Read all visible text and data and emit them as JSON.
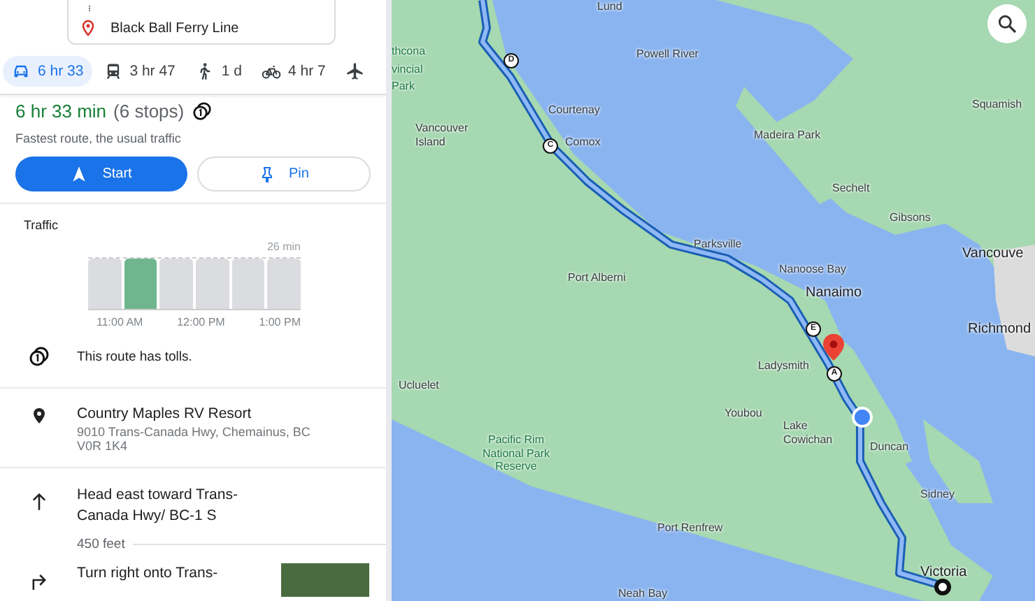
{
  "destination_card": {
    "label": "Black Ball Ferry Line"
  },
  "modes": [
    {
      "kind": "car",
      "label": "6 hr 33",
      "selected": true
    },
    {
      "kind": "transit",
      "label": "3 hr 47",
      "selected": false
    },
    {
      "kind": "walk",
      "label": "1 d",
      "selected": false
    },
    {
      "kind": "bike",
      "label": "4 hr 7",
      "selected": false
    },
    {
      "kind": "flight",
      "selected": false
    }
  ],
  "summary": {
    "duration": "6 hr 33 min",
    "stops": "(6 stops)",
    "note": "Fastest route, the usual traffic"
  },
  "buttons": {
    "start": "Start",
    "pin": "Pin"
  },
  "traffic": {
    "title": "Traffic",
    "top_label": "26 min",
    "times": [
      "11:00 AM",
      "12:00 PM",
      "1:00 PM"
    ],
    "bars": [
      {
        "selected": false
      },
      {
        "selected": true
      },
      {
        "selected": false
      },
      {
        "selected": false
      },
      {
        "selected": false
      },
      {
        "selected": false
      }
    ]
  },
  "tolls_note": "This route has tolls.",
  "place": {
    "name": "Country Maples RV Resort",
    "address": "9010 Trans-Canada Hwy, Chemainus, BC V0R 1K4"
  },
  "steps": [
    {
      "kind": "straight",
      "text": "Head east toward Trans-Canada Hwy/ BC-1 S",
      "distance": "450 feet"
    },
    {
      "kind": "right",
      "text": "Turn right onto Trans-",
      "photo": true
    }
  ],
  "map": {
    "labels": [
      {
        "text": "thcona",
        "kind": "park"
      },
      {
        "text": "vincial",
        "kind": "park"
      },
      {
        "text": "Park",
        "kind": "park"
      },
      {
        "text": "Lund",
        "kind": "town"
      },
      {
        "text": "Powell River",
        "kind": "town"
      },
      {
        "text": "Courtenay",
        "kind": "town"
      },
      {
        "text": "Vancouver Island",
        "kind": "town"
      },
      {
        "text": "Comox",
        "kind": "town"
      },
      {
        "text": "Madeira Park",
        "kind": "town"
      },
      {
        "text": "Squamish",
        "kind": "town"
      },
      {
        "text": "Sechelt",
        "kind": "town"
      },
      {
        "text": "Gibsons",
        "kind": "town"
      },
      {
        "text": "Vancouve",
        "kind": "city"
      },
      {
        "text": "Parksville",
        "kind": "town"
      },
      {
        "text": "Port Alberni",
        "kind": "town"
      },
      {
        "text": "Nanoose Bay",
        "kind": "town"
      },
      {
        "text": "Nanaimo",
        "kind": "city"
      },
      {
        "text": "Richmond",
        "kind": "city"
      },
      {
        "text": "Ladysmith",
        "kind": "town"
      },
      {
        "text": "Ucluelet",
        "kind": "town"
      },
      {
        "text": "Youbou",
        "kind": "town"
      },
      {
        "text": "Lake Cowichan",
        "kind": "town"
      },
      {
        "text": "Duncan",
        "kind": "town"
      },
      {
        "text": "Pacific Rim National Park Reserve",
        "kind": "park"
      },
      {
        "text": "Sidney",
        "kind": "town"
      },
      {
        "text": "Port Renfrew",
        "kind": "town"
      },
      {
        "text": "Victoria",
        "kind": "city"
      },
      {
        "text": "Neah Bay",
        "kind": "town"
      }
    ],
    "markers": [
      "D",
      "C",
      "E",
      "A"
    ]
  }
}
